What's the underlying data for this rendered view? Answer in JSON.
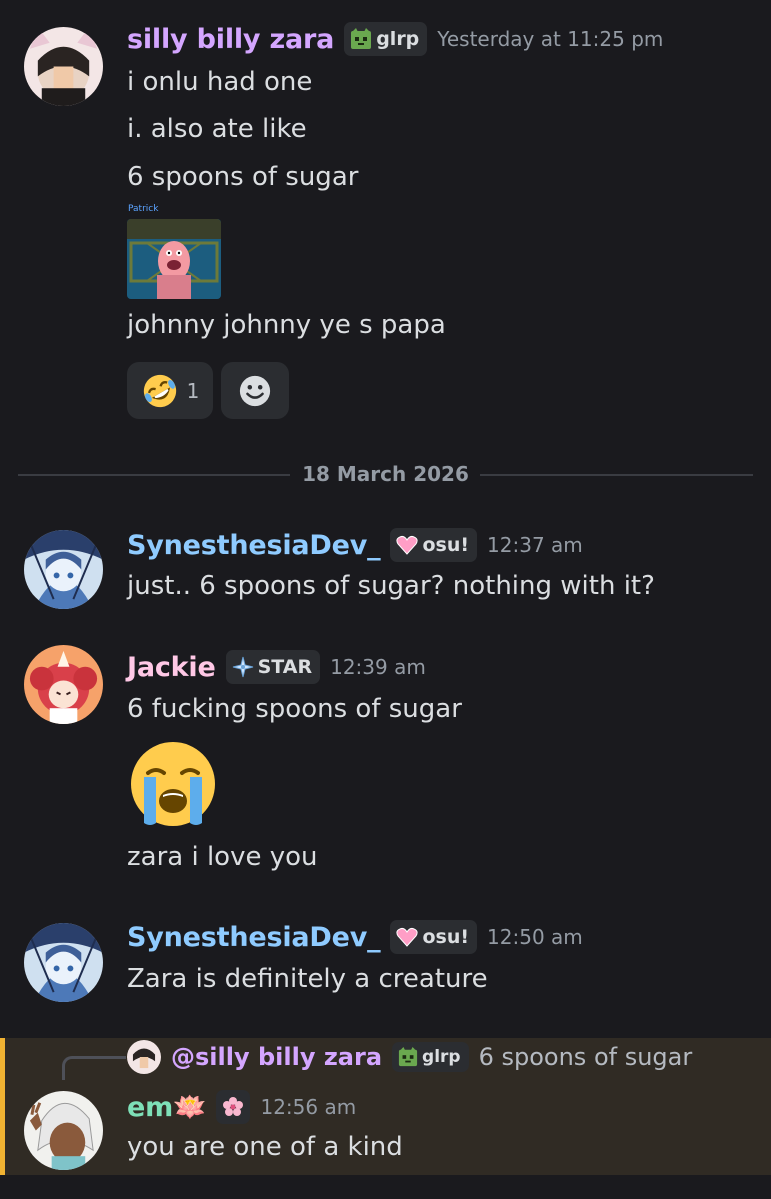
{
  "colors": {
    "background": "#1a1a1e",
    "zara": "#d4a6ff",
    "synesthesia": "#8fcbff",
    "jackie": "#ffc8e6",
    "em": "#7ee0b8",
    "reply_accent": "#f0b232"
  },
  "messages": [
    {
      "username": "silly billy zara",
      "tag": "glrp",
      "tag_icon": "cat-face-icon",
      "timestamp": "Yesterday at 11:25 pm",
      "lines": [
        "i onlu had one",
        "i. also ate like",
        "6 spoons of sugar",
        "johnny johnny ye s papa"
      ],
      "gif_caption": "Patrick",
      "reactions": [
        {
          "emoji": "rolling-on-floor-laughing-icon",
          "count": "1"
        },
        {
          "emoji": "add-reaction-icon"
        }
      ]
    },
    {
      "username": "SynesthesiaDev_",
      "tag": "osu!",
      "tag_icon": "pink-heart-icon",
      "timestamp": "12:37 am",
      "lines": [
        "just.. 6 spoons of sugar? nothing with it?"
      ]
    },
    {
      "username": "Jackie",
      "tag": "STAR",
      "tag_icon": "diamond-star-icon",
      "timestamp": "12:39 am",
      "lines": [
        "6 fucking spoons of sugar",
        "zara i love you"
      ],
      "big_emoji": "loudly-crying-face-icon"
    },
    {
      "username": "SynesthesiaDev_",
      "tag": "osu!",
      "tag_icon": "pink-heart-icon",
      "timestamp": "12:50 am",
      "lines": [
        "Zara is definitely a creature"
      ]
    },
    {
      "reply": {
        "username": "@silly billy zara",
        "tag": "glrp",
        "text": "6 spoons of sugar"
      },
      "username": "em🪷",
      "tag_icon": "cherry-blossom-icon",
      "timestamp": "12:56 am",
      "lines": [
        "you are one of a kind"
      ]
    }
  ],
  "date_divider": "18 March 2026"
}
